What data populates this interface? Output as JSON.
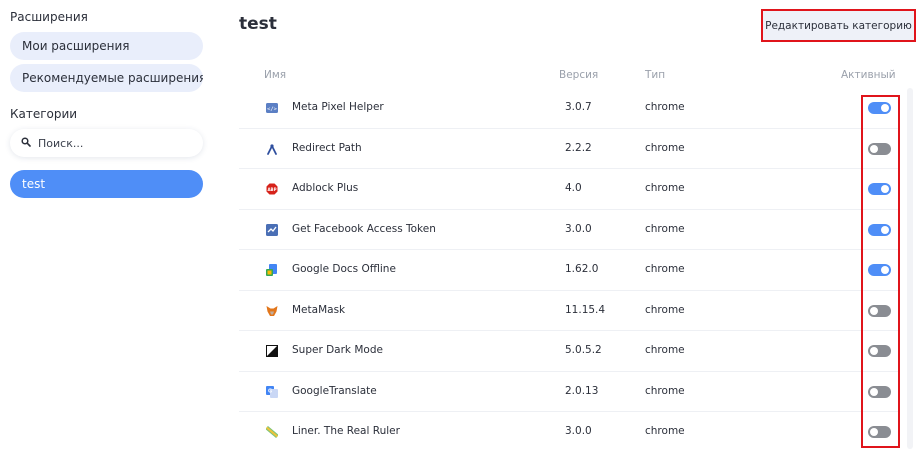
{
  "sidebar": {
    "extensions_heading": "Расширения",
    "my_extensions": "Мои расширения",
    "recommended_extensions": "Рекомендуемые расширения",
    "categories_heading": "Категории",
    "search_placeholder": "Поиск...",
    "categories": [
      {
        "label": "test",
        "selected": true
      }
    ]
  },
  "main": {
    "title": "test",
    "edit_button": "Редактировать категорию",
    "columns": {
      "name": "Имя",
      "version": "Версия",
      "type": "Тип",
      "active": "Активный"
    },
    "rows": [
      {
        "name": "Meta Pixel Helper",
        "version": "3.0.7",
        "type": "chrome",
        "active": true,
        "icon": "meta-pixel-helper-icon"
      },
      {
        "name": "Redirect Path",
        "version": "2.2.2",
        "type": "chrome",
        "active": false,
        "icon": "redirect-path-icon"
      },
      {
        "name": "Adblock Plus",
        "version": "4.0",
        "type": "chrome",
        "active": true,
        "icon": "adblock-plus-icon"
      },
      {
        "name": "Get Facebook Access Token",
        "version": "3.0.0",
        "type": "chrome",
        "active": true,
        "icon": "facebook-token-icon"
      },
      {
        "name": "Google Docs Offline",
        "version": "1.62.0",
        "type": "chrome",
        "active": true,
        "icon": "google-docs-offline-icon"
      },
      {
        "name": "MetaMask",
        "version": "11.15.4",
        "type": "chrome",
        "active": false,
        "icon": "metamask-fox-icon"
      },
      {
        "name": "Super Dark Mode",
        "version": "5.0.5.2",
        "type": "chrome",
        "active": false,
        "icon": "dark-mode-icon"
      },
      {
        "name": "GoogleTranslate",
        "version": "2.0.13",
        "type": "chrome",
        "active": false,
        "icon": "google-translate-icon"
      },
      {
        "name": "Liner. The Real Ruler",
        "version": "3.0.0",
        "type": "chrome",
        "active": false,
        "icon": "ruler-icon"
      }
    ]
  },
  "colors": {
    "accent": "#4f8ef7",
    "highlight": "#e0141b",
    "pill_bg": "#e9eefb",
    "toggle_off": "#8a8d93"
  }
}
